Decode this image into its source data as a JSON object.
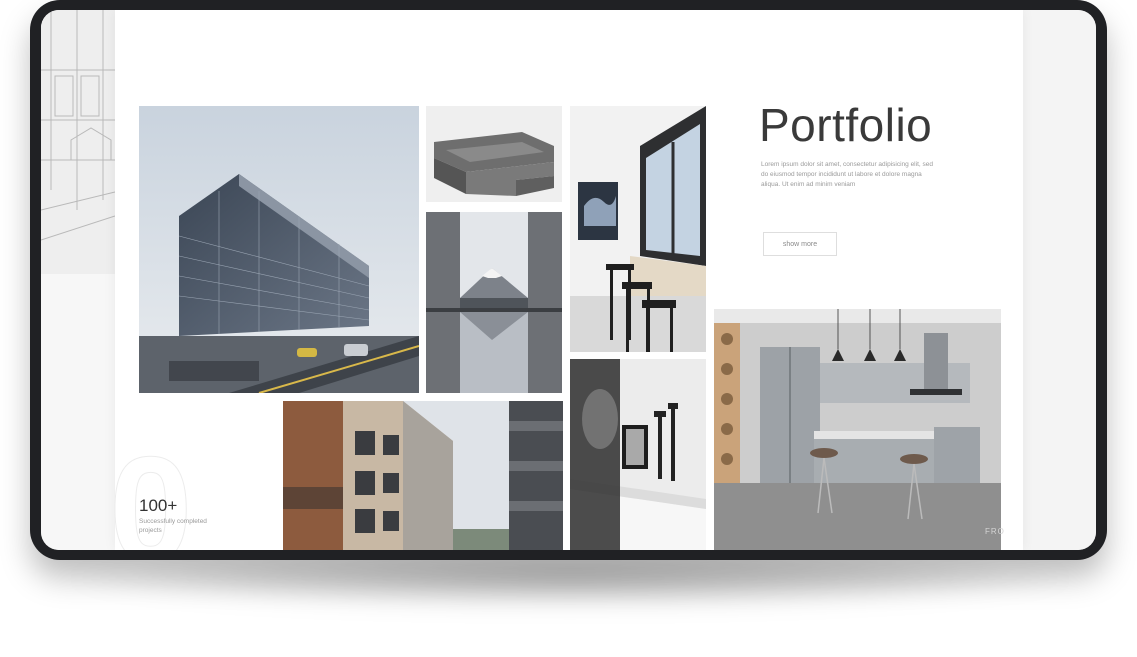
{
  "portfolio": {
    "title": "Portfolio",
    "description": "Lorem ipsum dolor sit amet, consectetur adipisicing elit, sed do eiusmod tempor incididunt ut labore et dolore magna aliqua. Ut enim ad minim veniam",
    "show_more_label": "show more"
  },
  "stats": {
    "number": "100+",
    "label": "Successfully completed projects",
    "background_digit": "0"
  },
  "watermark": "FRO",
  "gallery": [
    {
      "name": "office-building-photo"
    },
    {
      "name": "sofa-photo"
    },
    {
      "name": "mountain-reflection-photo"
    },
    {
      "name": "bar-interior-photo"
    },
    {
      "name": "apartment-building-photo"
    },
    {
      "name": "shelf-decor-photo"
    },
    {
      "name": "kitchen-interior-photo"
    }
  ],
  "colors": {
    "device_frame": "#202124",
    "page_background": "#ffffff",
    "title_text": "#3a3a3a",
    "muted_text": "#9a9a9a"
  }
}
